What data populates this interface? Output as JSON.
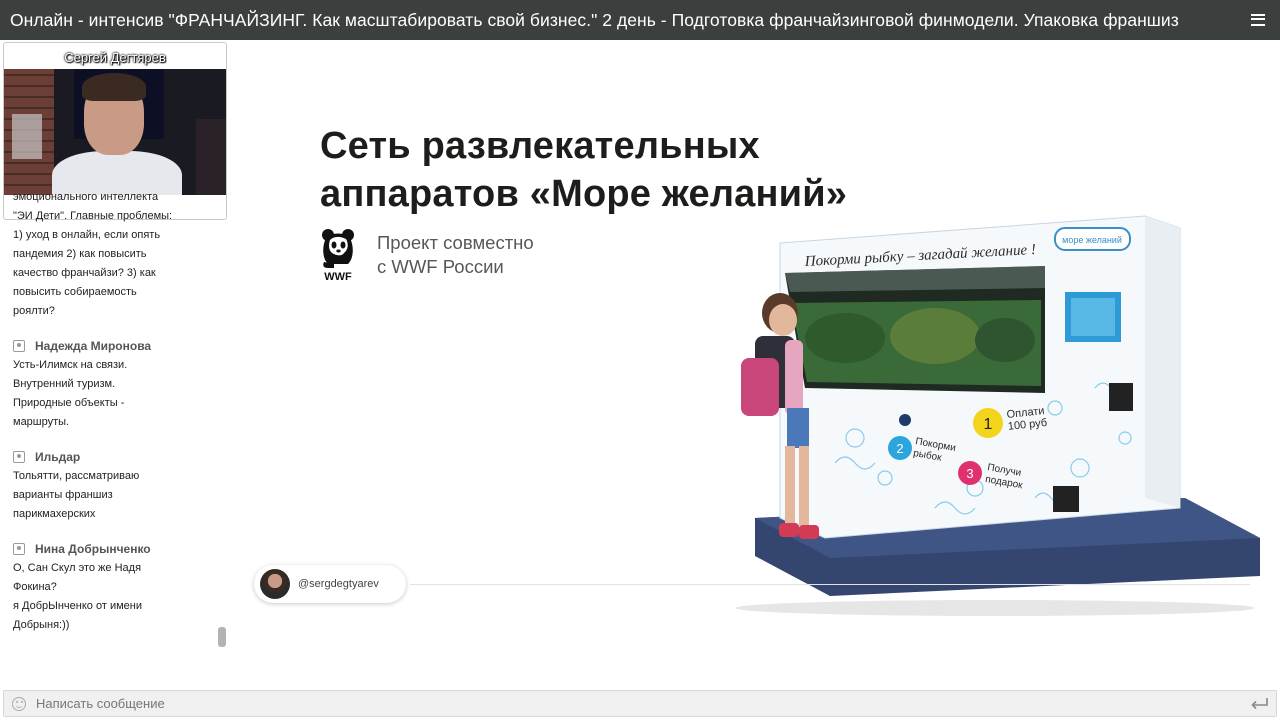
{
  "window": {
    "title": "Онлайн - интенсив \"ФРАНЧАЙЗИНГ. Как масштабировать свой бизнес.\" 2 день - Подготовка франчайзинговой финмодели. Упаковка франшиз",
    "menu_icon": "hamburger-icon"
  },
  "speaker": {
    "name": "Сергей Дегтярев"
  },
  "chat": {
    "partial_message": "эмоционального интеллекта\n\"ЭИ Дети\". Главные проблемы:\n1) уход в онлайн, если опять\nпандемия 2) как повысить\nкачество франчайзи? 3) как\nповысить собираемость\nроялти?",
    "messages": [
      {
        "author": "Надежда Миронова",
        "text": "Усть-Илимск на связи.\nВнутренний туризм.\nПриродные объекты -\nмаршруты."
      },
      {
        "author": "Ильдар",
        "text": "Тольятти, рассматриваю\nварианты франшиз\nпарикмахерских"
      },
      {
        "author": "Нина Добрынченко",
        "text": "О, Сан Скул это же Надя\nФокина?\nя ДобрЫнченко от имени\nДобрыня:))"
      }
    ]
  },
  "slide": {
    "title_line1": "Сеть развлекательных",
    "title_line2": "аппаратов «Море желаний»",
    "wwf_label": "WWF",
    "wwf_text": "Проект совместно\nс WWF России",
    "machine": {
      "banner": "Покорми рыбку – загадай желание !",
      "brand": "море желаний",
      "step1_num": "1",
      "step1_text": "Оплати\n100 руб",
      "step2_num": "2",
      "step2_text": "Покорми\nрыбок",
      "step3_num": "3",
      "step3_text": "Получи\nподарок"
    },
    "author_handle": "@sergdegtyarev"
  },
  "composer": {
    "placeholder": "Написать сообщение"
  },
  "colors": {
    "topbar": "#3b3f3e",
    "machine_blue": "#3a8fc7",
    "step1": "#f2d51b",
    "step2": "#2aa6dd",
    "step3": "#e0316e",
    "platform": "#3c4f80"
  }
}
